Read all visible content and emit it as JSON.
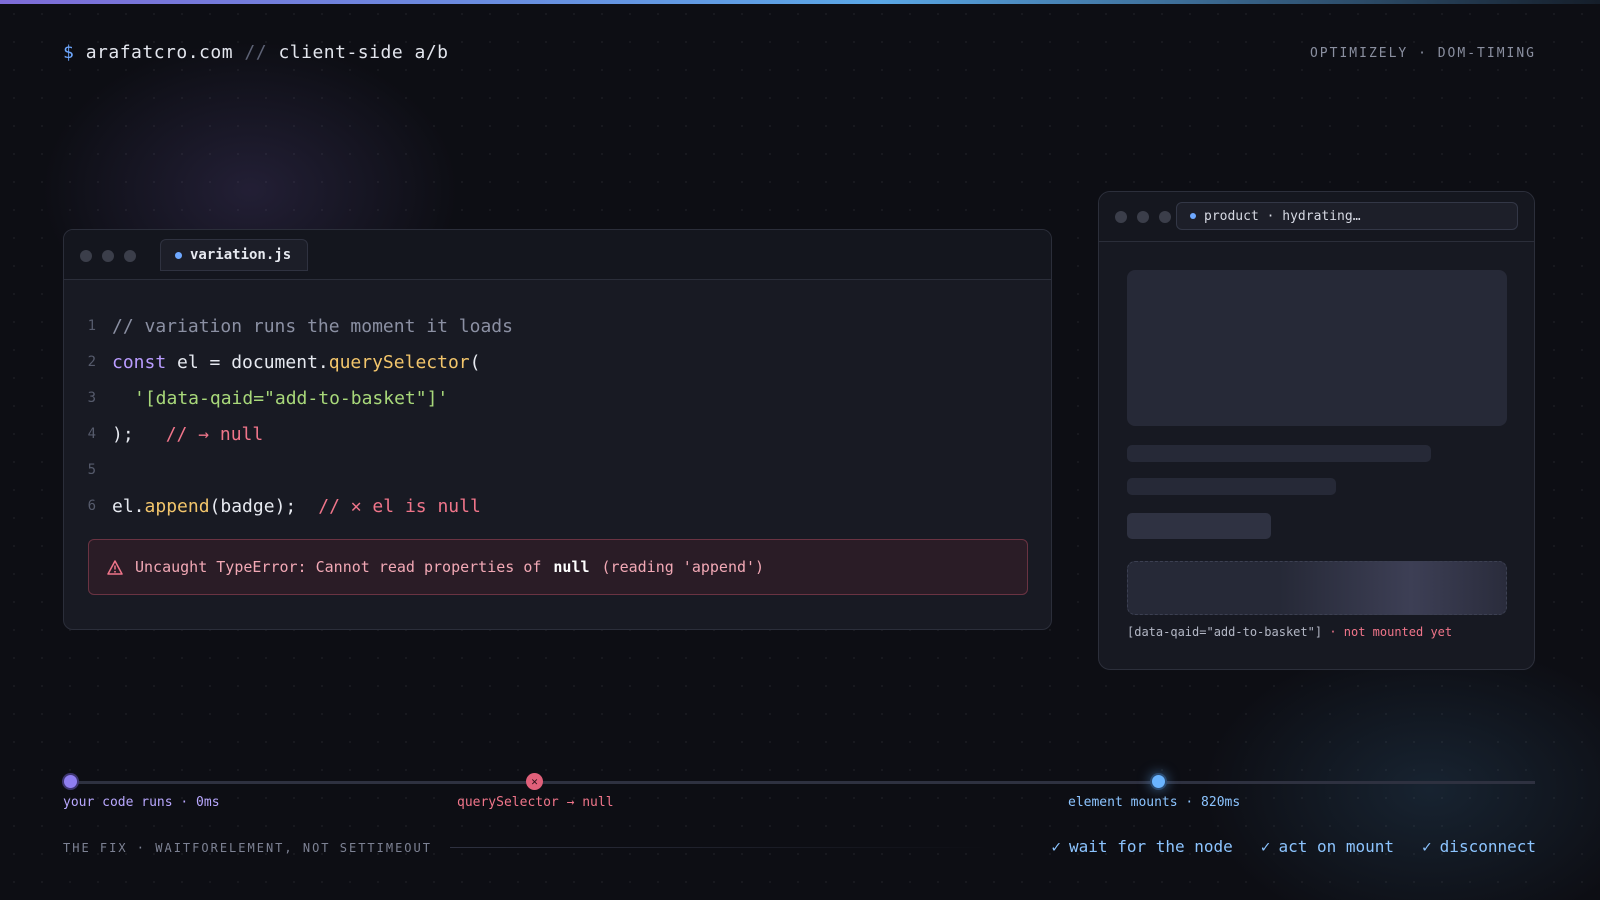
{
  "header": {
    "prompt": "$",
    "site": "arafatcro.com",
    "separator": "//",
    "section": "client-side a/b",
    "tagline": "OPTIMIZELY · DOM-TIMING"
  },
  "editor": {
    "tab_label": "variation.js",
    "lines": [
      {
        "num": "1",
        "comment": "// variation runs the moment it loads"
      },
      {
        "num": "2",
        "kw": "const",
        "ident": " el = document.",
        "fn": "querySelector",
        "punct": "("
      },
      {
        "num": "3",
        "str": "'[data-qaid=\"add-to-basket\"]'"
      },
      {
        "num": "4",
        "punct": ");",
        "err": "// → null"
      },
      {
        "num": "5"
      },
      {
        "num": "6",
        "ident": "el.",
        "fn": "append",
        "args": "(badge);",
        "err": "// ✕ el is null"
      }
    ],
    "error": {
      "prefix": "Uncaught TypeError: Cannot read properties of",
      "null_word": "null",
      "suffix": "(reading 'append')"
    }
  },
  "browser": {
    "address": "product · hydrating…",
    "slot_selector": "[data-qaid=\"add-to-basket\"]",
    "slot_status": "· not mounted yet"
  },
  "timeline": {
    "events": [
      {
        "label": "your code runs · 0ms"
      },
      {
        "label": "querySelector → null"
      },
      {
        "label": "element mounts · 820ms"
      }
    ]
  },
  "footer": {
    "fix_label": "THE FIX · WAITFORELEMENT, NOT SETTIMEOUT",
    "checks": [
      "wait for the node",
      "act on mount",
      "disconnect"
    ]
  },
  "colors": {
    "accent_purple": "#8f7ef0",
    "accent_blue": "#6ea8ff",
    "error_red": "#f0758a",
    "string_green": "#a8d87a",
    "function_yellow": "#f2c56b"
  }
}
